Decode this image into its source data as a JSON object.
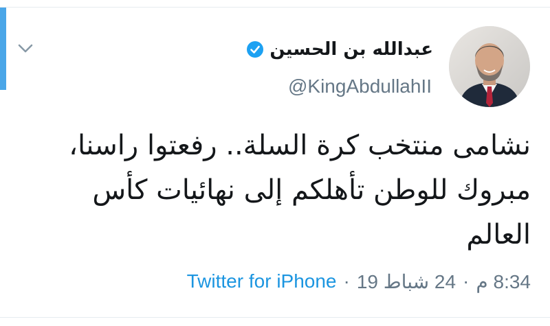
{
  "tweet": {
    "author": {
      "display_name": "عبدالله بن الحسين",
      "handle": "@KingAbdullahII",
      "verified": true
    },
    "text_lines": [
      "نشامى منتخب كرة السلة.. رفعتوا راسنا،",
      "مبروك للوطن تأهلكم إلى نهائيات كأس",
      "العالم"
    ],
    "meta": {
      "time": "8:34",
      "period": "م",
      "day": "24",
      "month": "شباط",
      "year": "19",
      "separator": "·",
      "source": "Twitter for iPhone"
    }
  },
  "icons": {
    "menu": "chevron-down-icon",
    "verified": "verified-badge-icon"
  },
  "colors": {
    "text": "#14171a",
    "secondary": "#657786",
    "link": "#1b95e0",
    "verified": "#1da1f2",
    "divider": "#e6ecf0",
    "accent": "#4aa6e8"
  }
}
